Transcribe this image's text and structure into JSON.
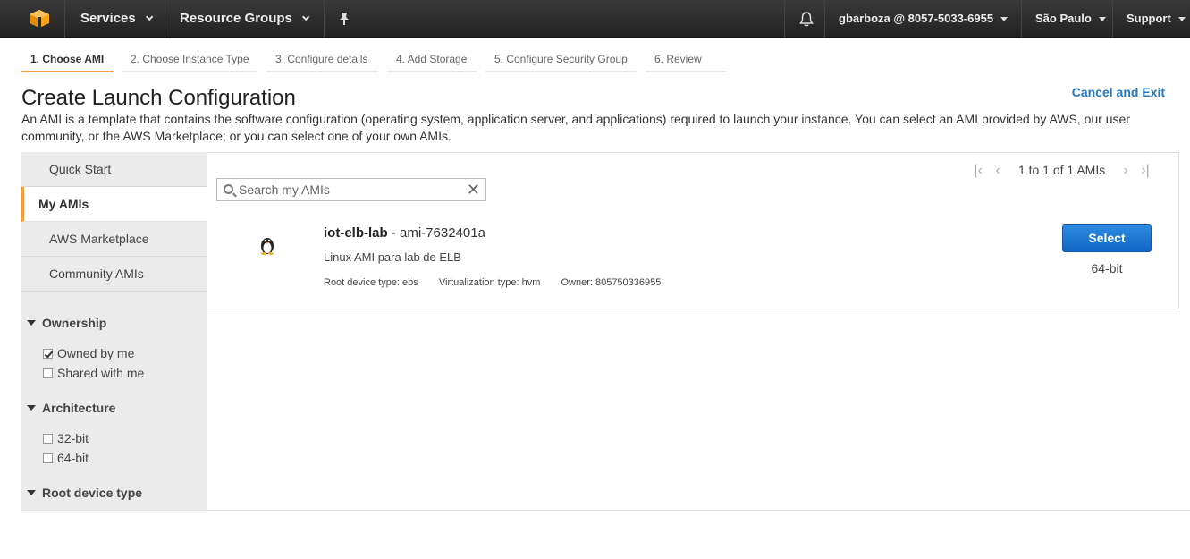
{
  "nav": {
    "services": "Services",
    "resource_groups": "Resource Groups",
    "account": "gbarboza @ 8057-5033-6955",
    "region": "São Paulo",
    "support": "Support"
  },
  "steps": [
    "1. Choose AMI",
    "2. Choose Instance Type",
    "3. Configure details",
    "4. Add Storage",
    "5. Configure Security Group",
    "6. Review"
  ],
  "page": {
    "title": "Create Launch Configuration",
    "cancel": "Cancel and Exit",
    "description": "An AMI is a template that contains the software configuration (operating system, application server, and applications) required to launch your instance. You can select an AMI provided by AWS, our user community, or the AWS Marketplace; or you can select one of your own AMIs."
  },
  "sidebar": {
    "tabs": [
      "Quick Start",
      "My AMIs",
      "AWS Marketplace",
      "Community AMIs"
    ],
    "ownership": {
      "title": "Ownership",
      "options": [
        {
          "label": "Owned by me",
          "checked": true
        },
        {
          "label": "Shared with me",
          "checked": false
        }
      ]
    },
    "architecture": {
      "title": "Architecture",
      "options": [
        {
          "label": "32-bit",
          "checked": false
        },
        {
          "label": "64-bit",
          "checked": false
        }
      ]
    },
    "root_device": {
      "title": "Root device type"
    }
  },
  "search": {
    "placeholder": "Search my AMIs",
    "value": ""
  },
  "pager": {
    "text": "1 to 1 of 1 AMIs"
  },
  "ami": {
    "name": "iot-elb-lab",
    "id_sep": " - ami-7632401a",
    "description": "Linux AMI para lab de ELB",
    "root_device": "Root device type: ebs",
    "virtualization": "Virtualization type: hvm",
    "owner": "Owner: 805750336955",
    "select_label": "Select",
    "arch": "64-bit"
  },
  "icons": {
    "logo": "aws-cube-icon",
    "pin": "pin-icon",
    "bell": "bell-icon",
    "linux": "linux-penguin-icon",
    "search": "search-icon",
    "clear": "clear-icon"
  },
  "colors": {
    "accent": "#f19e38",
    "link": "#1f79c7",
    "primary_button": "#1b75d0",
    "nav_bg": "#2b2b2b"
  }
}
